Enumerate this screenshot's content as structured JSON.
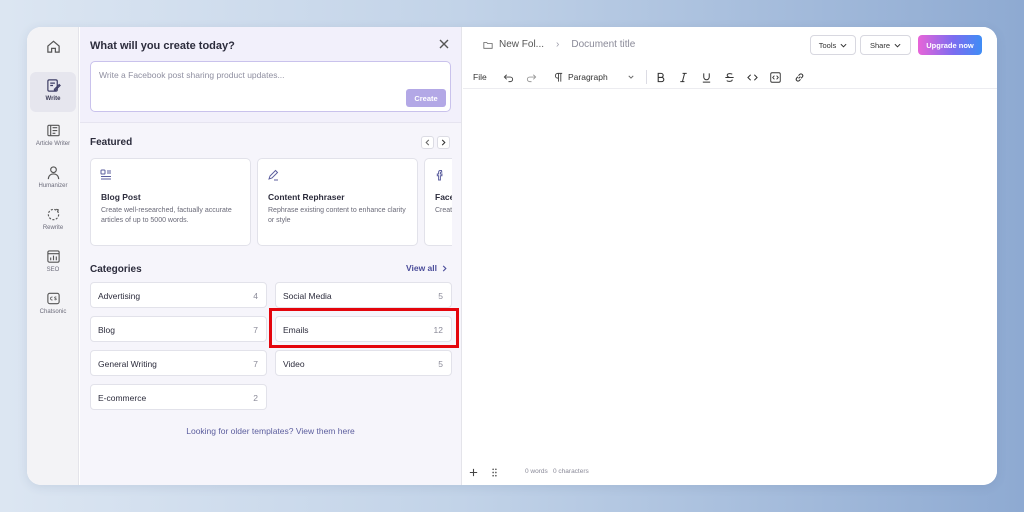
{
  "rail": {
    "items": [
      {
        "label": ""
      },
      {
        "label": "Write"
      },
      {
        "label": "Article Writer"
      },
      {
        "label": "Humanizer"
      },
      {
        "label": "Rewrite"
      },
      {
        "label": "SEO"
      },
      {
        "label": "Chatsonic"
      }
    ]
  },
  "panel": {
    "title": "What will you create today?",
    "prompt_placeholder": "Write a Facebook post sharing product updates...",
    "create_label": "Create",
    "featured_title": "Featured",
    "featured": [
      {
        "title": "Blog Post",
        "desc": "Create well-researched, factually accurate articles of up to 5000 words."
      },
      {
        "title": "Content Rephraser",
        "desc": "Rephrase existing content to enhance clarity or style"
      },
      {
        "title": "Facebook Post",
        "desc": "Create engaging Facebook posts"
      }
    ],
    "categories_title": "Categories",
    "view_all": "View all",
    "categories": [
      {
        "name": "Advertising",
        "count": "4"
      },
      {
        "name": "Social Media",
        "count": "5"
      },
      {
        "name": "Blog",
        "count": "7"
      },
      {
        "name": "Emails",
        "count": "12"
      },
      {
        "name": "General Writing",
        "count": "7"
      },
      {
        "name": "Video",
        "count": "5"
      },
      {
        "name": "E-commerce",
        "count": "2"
      }
    ],
    "older_templates": "Looking for older templates? View them here"
  },
  "editor": {
    "folder": "New Fol...",
    "doc_title": "Document title",
    "tools": "Tools",
    "share": "Share",
    "upgrade": "Upgrade now",
    "toolbar": {
      "file": "File",
      "paragraph": "Paragraph"
    },
    "status": {
      "words": "0 words",
      "chars": "0 characters"
    }
  },
  "colors": {
    "accent": "#4b4d9a",
    "highlight": "#e4050c",
    "create_button": "#b3a8e6"
  }
}
